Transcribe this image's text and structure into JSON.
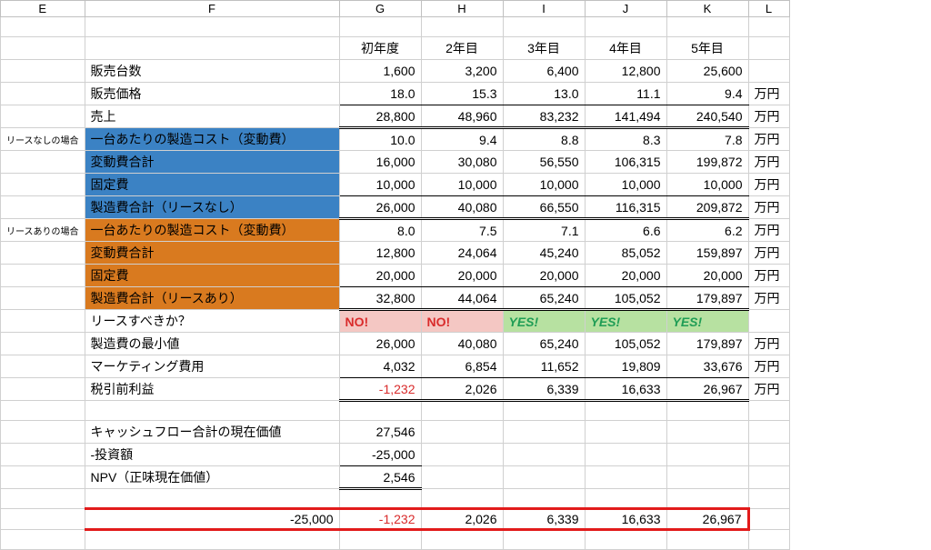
{
  "cols": {
    "E": "E",
    "F": "F",
    "G": "G",
    "H": "H",
    "I": "I",
    "J": "J",
    "K": "K",
    "L": "L"
  },
  "yearHeaders": {
    "y1": "初年度",
    "y2": "2年目",
    "y3": "3年目",
    "y4": "4年目",
    "y5": "5年目"
  },
  "labels": {
    "unitsSold": "販売台数",
    "unitPrice": "販売価格",
    "revenue": "売上",
    "noLease": "リースなしの場合",
    "withLease": "リースありの場合",
    "mfgCostPerUnit": "一台あたりの製造コスト（変動費）",
    "varCostTotal": "変動費合計",
    "fixedCost": "固定費",
    "mfgTotalNoLease": "製造費合計（リースなし）",
    "mfgTotalWithLease": "製造費合計（リースあり）",
    "shouldLease": "リースすべきか？",
    "minMfgCost": "製造費の最小値",
    "marketing": "マーケティング費用",
    "pretaxProfit": "税引前利益",
    "pvCashflow": "キャッシュフロー合計の現在価値",
    "investment": "-投資額",
    "npv": "NPV（正味現在価値）",
    "unit10k": "万円"
  },
  "row": {
    "unitsSold": {
      "y1": "1,600",
      "y2": "3,200",
      "y3": "6,400",
      "y4": "12,800",
      "y5": "25,600"
    },
    "unitPrice": {
      "y1": "18.0",
      "y2": "15.3",
      "y3": "13.0",
      "y4": "11.1",
      "y5": "9.4"
    },
    "revenue": {
      "y1": "28,800",
      "y2": "48,960",
      "y3": "83,232",
      "y4": "141,494",
      "y5": "240,540"
    },
    "nl_perUnit": {
      "y1": "10.0",
      "y2": "9.4",
      "y3": "8.8",
      "y4": "8.3",
      "y5": "7.8"
    },
    "nl_varTotal": {
      "y1": "16,000",
      "y2": "30,080",
      "y3": "56,550",
      "y4": "106,315",
      "y5": "199,872"
    },
    "nl_fixed": {
      "y1": "10,000",
      "y2": "10,000",
      "y3": "10,000",
      "y4": "10,000",
      "y5": "10,000"
    },
    "nl_total": {
      "y1": "26,000",
      "y2": "40,080",
      "y3": "66,550",
      "y4": "116,315",
      "y5": "209,872"
    },
    "wl_perUnit": {
      "y1": "8.0",
      "y2": "7.5",
      "y3": "7.1",
      "y4": "6.6",
      "y5": "6.2"
    },
    "wl_varTotal": {
      "y1": "12,800",
      "y2": "24,064",
      "y3": "45,240",
      "y4": "85,052",
      "y5": "159,897"
    },
    "wl_fixed": {
      "y1": "20,000",
      "y2": "20,000",
      "y3": "20,000",
      "y4": "20,000",
      "y5": "20,000"
    },
    "wl_total": {
      "y1": "32,800",
      "y2": "44,064",
      "y3": "65,240",
      "y4": "105,052",
      "y5": "179,897"
    },
    "shouldLease": {
      "y1": "NO!",
      "y2": "NO!",
      "y3": "YES!",
      "y4": "YES!",
      "y5": "YES!"
    },
    "minMfg": {
      "y1": "26,000",
      "y2": "40,080",
      "y3": "65,240",
      "y4": "105,052",
      "y5": "179,897"
    },
    "marketing": {
      "y1": "4,032",
      "y2": "6,854",
      "y3": "11,652",
      "y4": "19,809",
      "y5": "33,676"
    },
    "pretax": {
      "y1": "-1,232",
      "y2": "2,026",
      "y3": "6,339",
      "y4": "16,633",
      "y5": "26,967"
    },
    "pvCashflow": "27,546",
    "investment": "-25,000",
    "npv": "2,546",
    "bottom": {
      "F": "-25,000",
      "y1": "-1,232",
      "y2": "2,026",
      "y3": "6,339",
      "y4": "16,633",
      "y5": "26,967"
    }
  }
}
